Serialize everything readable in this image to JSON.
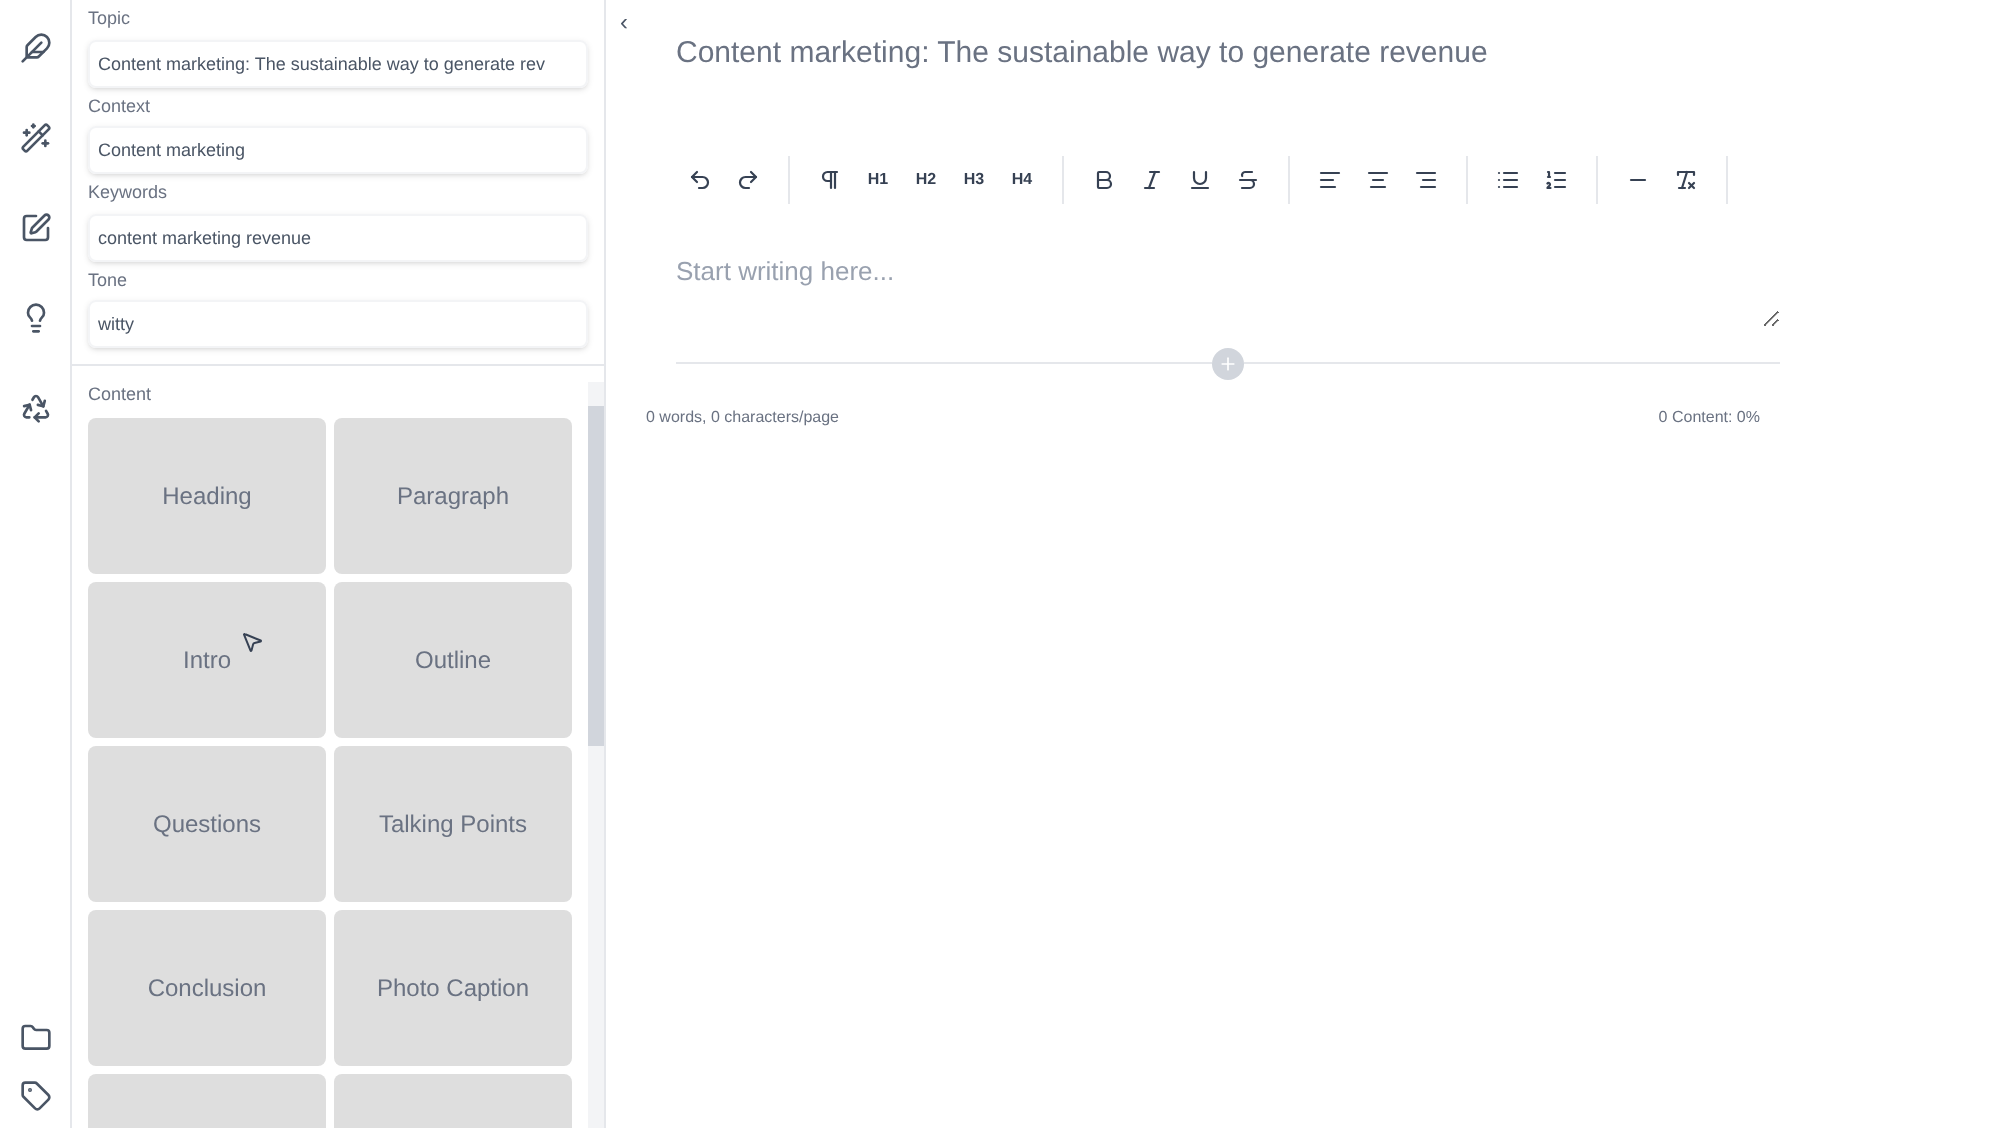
{
  "form": [
    {
      "label": "Topic",
      "value": "Content marketing: The sustainable way to generate rev"
    },
    {
      "label": "Context",
      "value": "Content marketing"
    },
    {
      "label": "Keywords",
      "value": "content marketing revenue"
    },
    {
      "label": "Tone",
      "value": "witty"
    }
  ],
  "content": {
    "label": "Content",
    "cards": [
      "Heading",
      "Paragraph",
      "Intro",
      "Outline",
      "Questions",
      "Talking Points",
      "Conclusion",
      "Photo Caption"
    ]
  },
  "collapse": "‹",
  "editor": {
    "title": "Content marketing: The sustainable way to generate revenue",
    "placeholder": "Start writing here...",
    "headings": [
      "H1",
      "H2",
      "H3",
      "H4"
    ],
    "stats_left": "0 words, 0 characters/page",
    "stats_right": "0 Content: 0%"
  }
}
